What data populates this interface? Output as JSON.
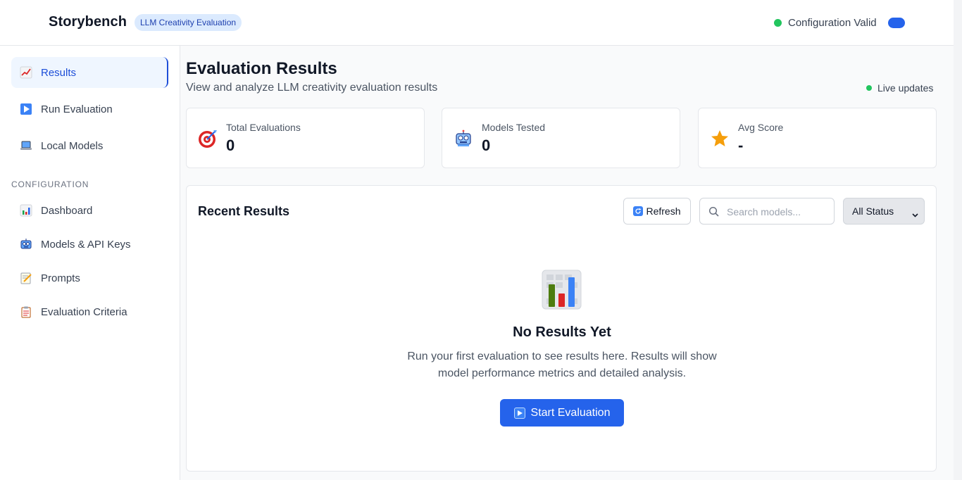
{
  "app": {
    "title": "Storybench",
    "badge": "LLM Creativity Evaluation",
    "config_status": "Configuration Valid",
    "status_color": "#22c55e",
    "accent": "#2563eb"
  },
  "sidebar": {
    "items": [
      {
        "label": "Results",
        "icon": "chart-increasing-icon",
        "active": true
      },
      {
        "label": "Run Evaluation",
        "icon": "play-button-icon",
        "active": false
      },
      {
        "label": "Local Models",
        "icon": "laptop-icon",
        "active": false
      }
    ],
    "section_label": "CONFIGURATION",
    "config_items": [
      {
        "label": "Dashboard",
        "icon": "bar-chart-icon"
      },
      {
        "label": "Models & API Keys",
        "icon": "robot-icon"
      },
      {
        "label": "Prompts",
        "icon": "memo-icon"
      },
      {
        "label": "Evaluation Criteria",
        "icon": "clipboard-icon"
      }
    ]
  },
  "main": {
    "title": "Evaluation Results",
    "subtitle": "View and analyze LLM creativity evaluation results",
    "live_updates": "Live updates",
    "stats": [
      {
        "label": "Total Evaluations",
        "value": "0",
        "icon": "target-icon"
      },
      {
        "label": "Models Tested",
        "value": "0",
        "icon": "robot-icon"
      },
      {
        "label": "Avg Score",
        "value": "-",
        "icon": "star-icon"
      }
    ],
    "results": {
      "title": "Recent Results",
      "refresh_label": "Refresh",
      "search_placeholder": "Search models...",
      "status_filter": "All Status",
      "empty_title": "No Results Yet",
      "empty_desc": "Run your first evaluation to see results here. Results will show model performance metrics and detailed analysis.",
      "start_label": "Start Evaluation"
    }
  }
}
